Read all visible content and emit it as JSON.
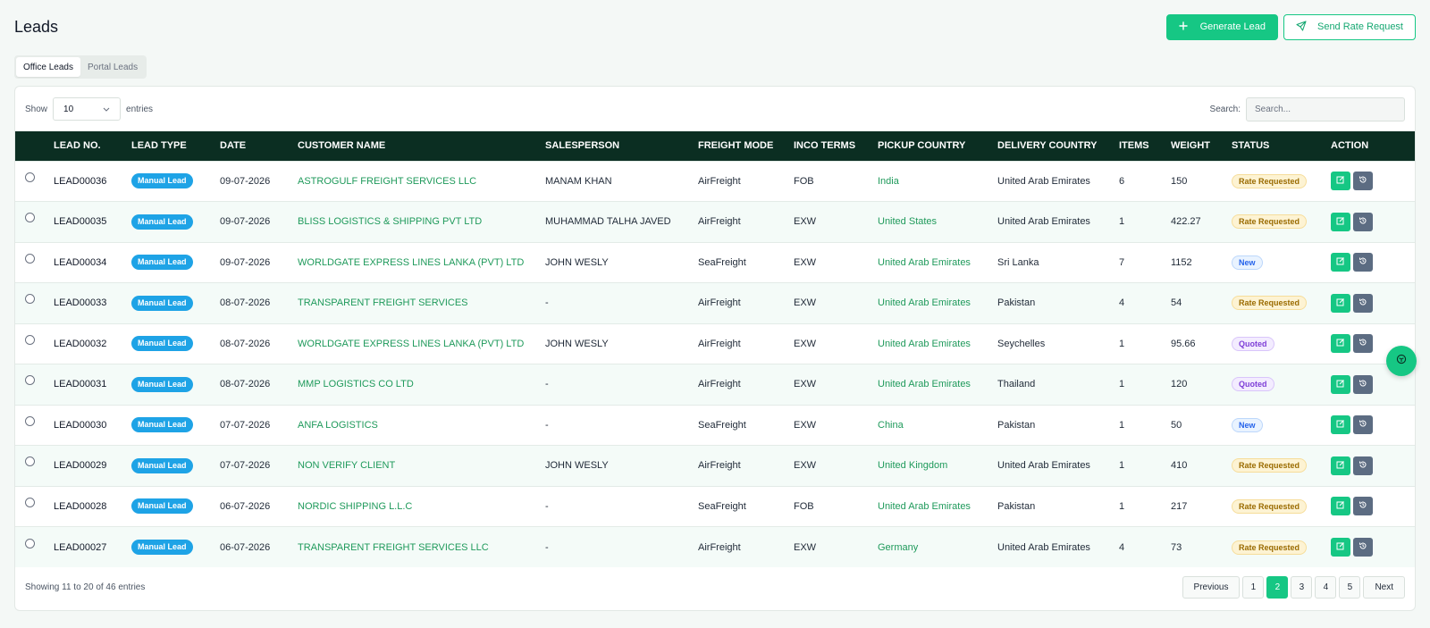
{
  "header": {
    "title": "Leads",
    "generate_label": "Generate Lead",
    "rate_request_label": "Send Rate Request"
  },
  "tabs": [
    {
      "label": "Office Leads",
      "active": true
    },
    {
      "label": "Portal Leads",
      "active": false
    }
  ],
  "toolbar": {
    "show_label": "Show",
    "entries_value": "10",
    "entries_label": "entries",
    "search_label": "Search:",
    "search_placeholder": "Search...",
    "search_value": ""
  },
  "columns": [
    "",
    "LEAD NO.",
    "LEAD TYPE",
    "DATE",
    "CUSTOMER NAME",
    "SALESPERSON",
    "FREIGHT MODE",
    "INCO TERMS",
    "PICKUP COUNTRY",
    "DELIVERY COUNTRY",
    "ITEMS",
    "WEIGHT",
    "STATUS",
    "ACTION"
  ],
  "rows": [
    {
      "lead_no": "LEAD00036",
      "type": "Manual Lead",
      "date": "09-07-2026",
      "customer": "ASTROGULF FREIGHT SERVICES LLC",
      "salesperson": "MANAM KHAN",
      "freight": "AirFreight",
      "inco": "FOB",
      "pickup": "India",
      "delivery": "United Arab Emirates",
      "items": "6",
      "weight": "150",
      "status": "Rate Requested",
      "status_kind": "rate"
    },
    {
      "lead_no": "LEAD00035",
      "type": "Manual Lead",
      "date": "09-07-2026",
      "customer": "BLISS LOGISTICS & SHIPPING PVT LTD",
      "salesperson": "MUHAMMAD TALHA JAVED",
      "freight": "AirFreight",
      "inco": "EXW",
      "pickup": "United States",
      "delivery": "United Arab Emirates",
      "items": "1",
      "weight": "422.27",
      "status": "Rate Requested",
      "status_kind": "rate"
    },
    {
      "lead_no": "LEAD00034",
      "type": "Manual Lead",
      "date": "09-07-2026",
      "customer": "WORLDGATE EXPRESS LINES LANKA (PVT) LTD",
      "salesperson": "JOHN WESLY",
      "freight": "SeaFreight",
      "inco": "EXW",
      "pickup": "United Arab Emirates",
      "delivery": "Sri Lanka",
      "items": "7",
      "weight": "1152",
      "status": "New",
      "status_kind": "new"
    },
    {
      "lead_no": "LEAD00033",
      "type": "Manual Lead",
      "date": "08-07-2026",
      "customer": "TRANSPARENT FREIGHT SERVICES",
      "salesperson": "-",
      "freight": "AirFreight",
      "inco": "EXW",
      "pickup": "United Arab Emirates",
      "delivery": "Pakistan",
      "items": "4",
      "weight": "54",
      "status": "Rate Requested",
      "status_kind": "rate"
    },
    {
      "lead_no": "LEAD00032",
      "type": "Manual Lead",
      "date": "08-07-2026",
      "customer": "WORLDGATE EXPRESS LINES LANKA (PVT) LTD",
      "salesperson": "JOHN WESLY",
      "freight": "AirFreight",
      "inco": "EXW",
      "pickup": "United Arab Emirates",
      "delivery": "Seychelles",
      "items": "1",
      "weight": "95.66",
      "status": "Quoted",
      "status_kind": "quoted"
    },
    {
      "lead_no": "LEAD00031",
      "type": "Manual Lead",
      "date": "08-07-2026",
      "customer": "MMP LOGISTICS CO LTD",
      "salesperson": "-",
      "freight": "AirFreight",
      "inco": "EXW",
      "pickup": "United Arab Emirates",
      "delivery": "Thailand",
      "items": "1",
      "weight": "120",
      "status": "Quoted",
      "status_kind": "quoted"
    },
    {
      "lead_no": "LEAD00030",
      "type": "Manual Lead",
      "date": "07-07-2026",
      "customer": "ANFA LOGISTICS",
      "salesperson": "-",
      "freight": "SeaFreight",
      "inco": "EXW",
      "pickup": "China",
      "delivery": "Pakistan",
      "items": "1",
      "weight": "50",
      "status": "New",
      "status_kind": "new"
    },
    {
      "lead_no": "LEAD00029",
      "type": "Manual Lead",
      "date": "07-07-2026",
      "customer": "NON VERIFY CLIENT",
      "salesperson": "JOHN WESLY",
      "freight": "AirFreight",
      "inco": "EXW",
      "pickup": "United Kingdom",
      "delivery": "United Arab Emirates",
      "items": "1",
      "weight": "410",
      "status": "Rate Requested",
      "status_kind": "rate"
    },
    {
      "lead_no": "LEAD00028",
      "type": "Manual Lead",
      "date": "06-07-2026",
      "customer": "NORDIC SHIPPING L.L.C",
      "salesperson": "-",
      "freight": "SeaFreight",
      "inco": "FOB",
      "pickup": "United Arab Emirates",
      "delivery": "Pakistan",
      "items": "1",
      "weight": "217",
      "status": "Rate Requested",
      "status_kind": "rate"
    },
    {
      "lead_no": "LEAD00027",
      "type": "Manual Lead",
      "date": "06-07-2026",
      "customer": "TRANSPARENT FREIGHT SERVICES LLC",
      "salesperson": "-",
      "freight": "AirFreight",
      "inco": "EXW",
      "pickup": "Germany",
      "delivery": "United Arab Emirates",
      "items": "4",
      "weight": "73",
      "status": "Rate Requested",
      "status_kind": "rate"
    }
  ],
  "footer": {
    "info": "Showing 11 to 20 of 46 entries",
    "previous_label": "Previous",
    "next_label": "Next",
    "pages": [
      "1",
      "2",
      "3",
      "4",
      "5"
    ],
    "current_page": "2"
  },
  "colors": {
    "accent": "#16c784",
    "header_bg": "#0b2e22",
    "link": "#1f9a5b",
    "type_badge": "#1ea3e6"
  },
  "icons": {
    "generate": "plus-icon",
    "rate_request": "send-icon",
    "select": "chevron-down-icon",
    "edit": "edit-icon",
    "history": "history-icon",
    "fab": "package-icon"
  }
}
